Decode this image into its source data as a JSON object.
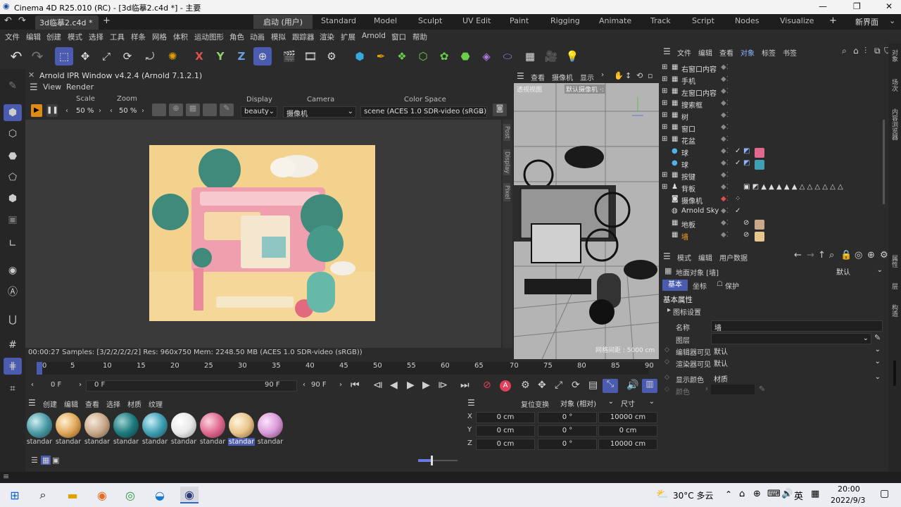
{
  "window": {
    "title": "Cinema 4D R25.010 (RC) - [3d临摹2.c4d *] - 主要",
    "min": "—",
    "max": "❐",
    "close": "✕"
  },
  "tabs": {
    "doc": "3d临摹2.c4d *",
    "add": "+",
    "layouts": [
      "启动 (用户)",
      "Standard",
      "Model",
      "Sculpt",
      "UV Edit",
      "Paint",
      "Rigging",
      "Animate",
      "Track",
      "Script",
      "Nodes",
      "Visualize"
    ],
    "new_interface": "新界面"
  },
  "menu": [
    "文件",
    "编辑",
    "创建",
    "模式",
    "选择",
    "工具",
    "样条",
    "网格",
    "体积",
    "运动图形",
    "角色",
    "动画",
    "模拟",
    "跟踪器",
    "渲染",
    "扩展",
    "Arnold",
    "窗口",
    "帮助"
  ],
  "ipr": {
    "title": "Arnold IPR Window v4.2.4 (Arnold 7.1.2.1)",
    "menu": [
      "View",
      "Render"
    ],
    "scale_label": "Scale",
    "scale_value": "50 %",
    "zoom_label": "Zoom",
    "zoom_value": "50 %",
    "display_label": "Display",
    "display_value": "beauty",
    "camera_label": "Camera",
    "camera_value": "摄像机",
    "colorspace_label": "Color Space",
    "colorspace_value": "scene (ACES 1.0 SDR-video (sRGB))",
    "side_tabs": [
      "Post",
      "Display",
      "Pixel"
    ],
    "status": "00:00:27  Samples: [3/2/2/2/2/2]  Res: 960x750  Mem: 2248.50 MB  (ACES 1.0 SDR-video (sRGB))"
  },
  "viewport": {
    "menu": [
      "查看",
      "摄像机",
      "显示"
    ],
    "label_left": "透视视图",
    "label_cam": "默认摄像机 ·:",
    "grid": "网格间距 : 5000 cm"
  },
  "timeline": {
    "ticks": [
      "0",
      "5",
      "10",
      "15",
      "20",
      "25",
      "30",
      "35",
      "40",
      "45",
      "50",
      "55",
      "60",
      "65",
      "70",
      "75",
      "80",
      "85",
      "90"
    ],
    "start": "0 F",
    "current": "0 F",
    "end": "90 F",
    "end2": "90 F"
  },
  "materials": {
    "menu": [
      "创建",
      "编辑",
      "查看",
      "选择",
      "材质",
      "纹理"
    ],
    "label": "standar",
    "items": [
      {
        "color": "#4a9aa6"
      },
      {
        "color": "#e0a85a"
      },
      {
        "color": "#c9a98a"
      },
      {
        "color": "#1e7a7e"
      },
      {
        "color": "#3f9fb3"
      },
      {
        "color": "#e8e8e8"
      },
      {
        "color": "#e06a8f"
      },
      {
        "color": "#e8c58c"
      },
      {
        "color": "#d99ad8"
      }
    ]
  },
  "coords": {
    "reset": "复位变换",
    "mode": "对象 (相对)",
    "size": "尺寸",
    "rows": [
      {
        "axis": "X",
        "pos": "0 cm",
        "rot": "0 °",
        "size": "10000 cm"
      },
      {
        "axis": "Y",
        "pos": "0 cm",
        "rot": "0 °",
        "size": "0 cm"
      },
      {
        "axis": "Z",
        "pos": "0 cm",
        "rot": "0 °",
        "size": "10000 cm"
      }
    ]
  },
  "objects": {
    "menu": [
      "文件",
      "编辑",
      "查看",
      "对象",
      "标签",
      "书签"
    ],
    "items": [
      "右窗口内容",
      "手机",
      "左窗口内容",
      "搜索框",
      "树",
      "窗口",
      "花盆",
      "球",
      "球",
      "按键",
      "背板",
      "摄像机",
      "Arnold Sky",
      "地板",
      "墙"
    ]
  },
  "attributes": {
    "menu": [
      "模式",
      "编辑",
      "用户数据"
    ],
    "object": "地面对象 [墙]",
    "preset": "默认",
    "tabs": [
      "基本",
      "坐标",
      "保护"
    ],
    "section": "基本属性",
    "subsection": "图标设置",
    "fields": [
      {
        "label": "名称",
        "value": "墙"
      },
      {
        "label": "图层",
        "value": ""
      },
      {
        "label": "编辑器可见",
        "value": "默认"
      },
      {
        "label": "渲染器可见",
        "value": "默认"
      },
      {
        "label": "显示颜色",
        "value": "材质"
      },
      {
        "label": "颜色",
        "value": ""
      }
    ]
  },
  "right_strip": [
    "对象",
    "场次",
    "内容浏览器",
    "属性",
    "层",
    "构造"
  ],
  "taskbar": {
    "weather": "30°C 多云",
    "ime": "英",
    "time": "20:00",
    "date": "2022/9/3"
  }
}
